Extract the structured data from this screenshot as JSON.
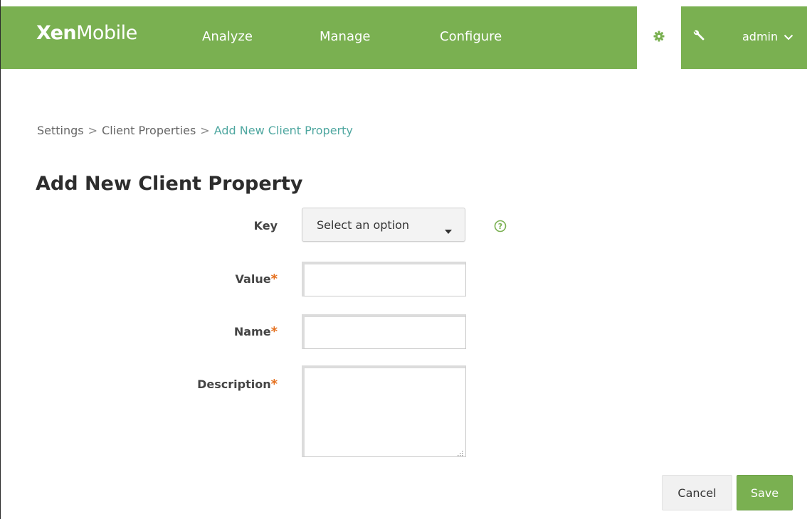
{
  "header": {
    "logo_bold": "Xen",
    "logo_light": "Mobile",
    "nav": [
      "Analyze",
      "Manage",
      "Configure"
    ],
    "user": "admin",
    "icons": [
      "gear-icon",
      "wrench-icon",
      "chevron-down-icon"
    ]
  },
  "breadcrumb": {
    "items": [
      "Settings",
      "Client Properties",
      "Add New Client Property"
    ],
    "separator": ">"
  },
  "page": {
    "title": "Add New Client Property"
  },
  "form": {
    "key_label": "Key",
    "key_placeholder": "Select an option",
    "value_label": "Value",
    "value": "",
    "name_label": "Name",
    "name": "",
    "description_label": "Description",
    "description": "",
    "required_marker": "*"
  },
  "actions": {
    "cancel_label": "Cancel",
    "save_label": "Save"
  },
  "colors": {
    "brand_green": "#7ab051",
    "breadcrumb_active": "#4fa7a0",
    "required": "#e5701e"
  }
}
